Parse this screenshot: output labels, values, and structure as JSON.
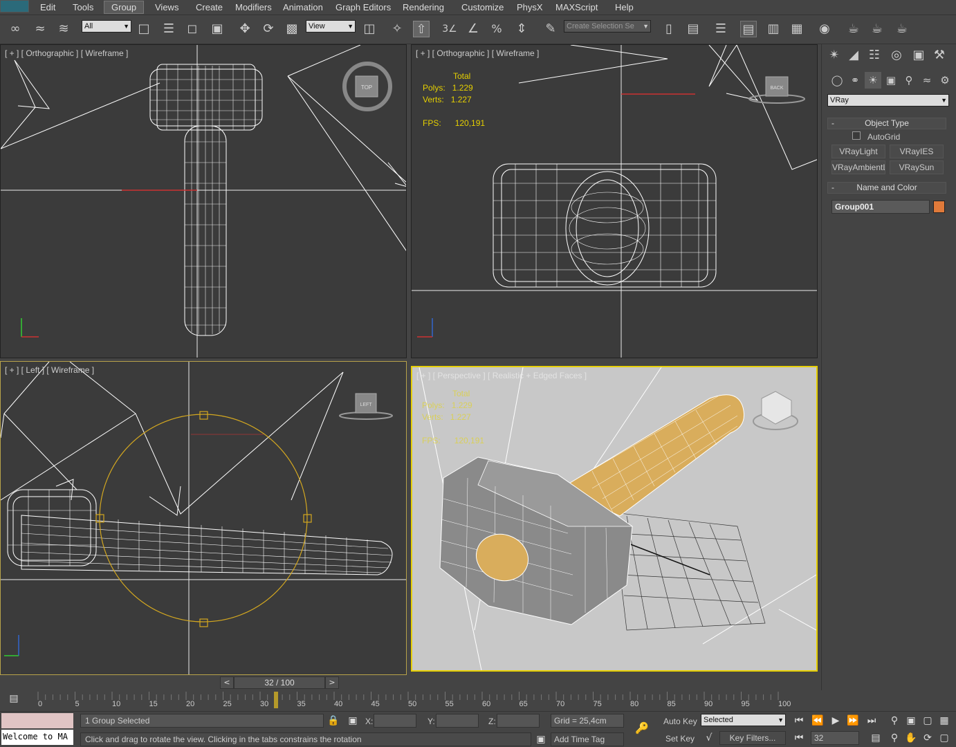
{
  "menus": [
    "Edit",
    "Tools",
    "Group",
    "Views",
    "Create",
    "Modifiers",
    "Animation",
    "Graph Editors",
    "Rendering",
    "Customize",
    "PhysX",
    "MAXScript",
    "Help"
  ],
  "toolbar": {
    "filter": "All",
    "refcoord": "View",
    "named_selection": "Create Selection Se"
  },
  "viewports": {
    "top": {
      "label": "[ + ] [ Orthographic ] [ Wireframe ]",
      "cube": "TOP"
    },
    "front": {
      "label": "[ + ] [ Orthographic ] [ Wireframe ]",
      "cube": "BACK",
      "total": "Total",
      "polys_label": "Polys:",
      "polys": "1.229",
      "verts_label": "Verts:",
      "verts": "1.227",
      "fps_label": "FPS:",
      "fps": "120,191"
    },
    "left": {
      "label": "[ + ] [ Left ] [ Wireframe ]",
      "cube": "LEFT"
    },
    "persp": {
      "label": "[ + ] [ Perspective ] [ Realistic + Edged Faces ]",
      "total": "Total",
      "polys_label": "Polys:",
      "polys": "1.229",
      "verts_label": "Verts:",
      "verts": "1.227",
      "fps_label": "FPS:",
      "fps": "120,191"
    }
  },
  "axis": {
    "x": "x",
    "y": "y",
    "z": "z"
  },
  "cmdpanel": {
    "renderer": "VRay",
    "object_type": "Object Type",
    "autogrid": "AutoGrid",
    "buttons": [
      "VRayLight",
      "VRayIES",
      "VRayAmbientLight",
      "VRaySun"
    ],
    "name_color": "Name and Color",
    "object_name": "Group001",
    "color": "#e07a3a"
  },
  "time": {
    "frame": "32 / 100",
    "ticks": [
      "0",
      "5",
      "10",
      "15",
      "20",
      "25",
      "30",
      "35",
      "40",
      "45",
      "50",
      "55",
      "60",
      "65",
      "70",
      "75",
      "80",
      "85",
      "90",
      "95",
      "100"
    ],
    "current_frame": "32"
  },
  "status": {
    "selection": "1 Group Selected",
    "prompt": "Click and drag to rotate the view.  Clicking in the tabs constrains the rotation",
    "welcome": "Welcome to MA",
    "x_label": "X:",
    "y_label": "Y:",
    "z_label": "Z:",
    "grid": "Grid = 25,4cm",
    "add_time_tag": "Add Time Tag",
    "auto_key": "Auto Key",
    "set_key": "Set Key",
    "key_mode": "Selected",
    "key_filters": "Key Filters..."
  }
}
